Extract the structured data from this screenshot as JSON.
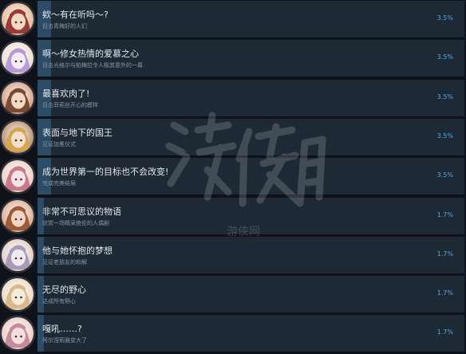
{
  "colors": {
    "background": "#0f1218",
    "panel": "#1d2935",
    "progress_fill": "#2c4b66",
    "title_text": "#e3e7ec",
    "description_text": "#8a96a4",
    "percent_text": "#5aa6df"
  },
  "achievements": [
    {
      "icon": "character-portrait-icon",
      "title": "欸～有在听吗～?",
      "description": "目击青梅好的人们",
      "percent": "3.5%",
      "unlocked_fraction": 0.035,
      "palette": [
        "#f2d9c0",
        "#9a3a3a",
        "#d9a87c"
      ]
    },
    {
      "icon": "character-portrait-icon",
      "title": "啊～修女热情的爱慕之心",
      "description": "目击光格尔与帕梅拉令人极其意外的一幕",
      "percent": "3.5%",
      "unlocked_fraction": 0.035,
      "palette": [
        "#f5ecf6",
        "#b79ad6",
        "#e9d5c5"
      ]
    },
    {
      "icon": "character-portrait-icon",
      "title": "最喜欢肉了!",
      "description": "目击菲莉丝开心的模样",
      "percent": "3.5%",
      "unlocked_fraction": 0.035,
      "palette": [
        "#f3d9c6",
        "#7b4a32",
        "#c98c6a"
      ]
    },
    {
      "icon": "character-portrait-icon",
      "title": "表面与地下的国王",
      "description": "见证加冕仪式",
      "percent": "3.5%",
      "unlocked_fraction": 0.035,
      "palette": [
        "#f2e1c8",
        "#d4a651",
        "#a8744a"
      ]
    },
    {
      "icon": "character-portrait-icon",
      "title": "成为世界第一的目标也不会改变!",
      "description": "完成完美结局",
      "percent": "3.5%",
      "unlocked_fraction": 0.035,
      "palette": [
        "#f7e2e6",
        "#c87a8a",
        "#e8c2b4"
      ]
    },
    {
      "icon": "character-portrait-icon",
      "title": "非常不可思议的物语",
      "description": "欣赏一场精采绝伦的人偶剧",
      "percent": "1.7%",
      "unlocked_fraction": 0.017,
      "palette": [
        "#f2d6c4",
        "#9e5b3c",
        "#d39a77"
      ]
    },
    {
      "icon": "character-portrait-icon",
      "title": "他与她怀抱的梦想",
      "description": "见证老朋友的和解",
      "percent": "1.7%",
      "unlocked_fraction": 0.017,
      "palette": [
        "#efe9f2",
        "#a79bb8",
        "#d9c2b6"
      ]
    },
    {
      "icon": "character-portrait-icon",
      "title": "无尽的野心",
      "description": "达成所有野心",
      "percent": "1.7%",
      "unlocked_fraction": 0.017,
      "palette": [
        "#f6ead8",
        "#d8b98c",
        "#e7cfb3"
      ]
    },
    {
      "icon": "character-portrait-icon",
      "title": "嘎吼……?",
      "description": "柯尔涅莉雅变大了",
      "percent": "1.7%",
      "unlocked_fraction": 0.017,
      "palette": [
        "#f5dde0",
        "#c48c9a",
        "#e6c0b8"
      ]
    }
  ],
  "watermark": {
    "icon": "watermark-logo-icon",
    "text": "游侠网"
  }
}
